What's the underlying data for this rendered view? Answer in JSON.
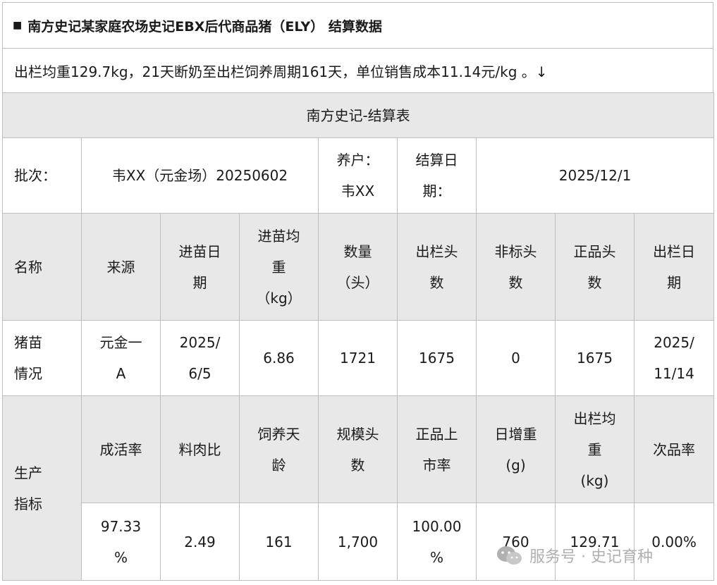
{
  "title": "南方史记某家庭农场史记EBX后代商品猪（ELY） 结算数据",
  "title_marker": "■",
  "summary": "出栏均重129.7kg，21天断奶至出栏饲养周期161天，单位销售成本11.14元/kg 。↓",
  "table": {
    "heading": "南方史记-结算表",
    "batch_label": "批次：",
    "batch_value": "韦XX（元金场）20250602",
    "farmer_label_1": "养户：",
    "farmer_label_2": "韦XX",
    "settle_label_1": "结算日",
    "settle_label_2": "期：",
    "settle_date": "2025/12/1",
    "headers": [
      [
        "名称"
      ],
      [
        "来源"
      ],
      [
        "进苗日",
        "期"
      ],
      [
        "进苗均",
        "重",
        "（kg）"
      ],
      [
        "数量",
        "（头）"
      ],
      [
        "出栏头",
        "数"
      ],
      [
        "非标头",
        "数"
      ],
      [
        "正品头",
        "数"
      ],
      [
        "出栏日",
        "期"
      ]
    ],
    "piglet_row": [
      [
        "猪苗",
        "情况"
      ],
      [
        "元金一",
        "A"
      ],
      [
        "2025/",
        "6/5"
      ],
      [
        "6.86"
      ],
      [
        "1721"
      ],
      [
        "1675"
      ],
      [
        "0"
      ],
      [
        "1675"
      ],
      [
        "2025/",
        "11/14"
      ]
    ],
    "production_label": [
      "生产",
      "指标"
    ],
    "indicator_headers": [
      [
        "成活率"
      ],
      [
        "料肉比"
      ],
      [
        "饲养天",
        "龄"
      ],
      [
        "规模头",
        "数"
      ],
      [
        "正品上",
        "市率"
      ],
      [
        "日增重",
        "(g)"
      ],
      [
        "出栏均",
        "重",
        "(kg)"
      ],
      [
        "次品率"
      ]
    ],
    "indicator_values": [
      [
        "97.33",
        "%"
      ],
      [
        "2.49"
      ],
      [
        "161"
      ],
      [
        "1,700"
      ],
      [
        "100.00",
        "%"
      ],
      [
        "760"
      ],
      [
        "129.71"
      ],
      [
        "0.00%"
      ]
    ]
  },
  "watermark": {
    "text": "服务号 · 史记育种",
    "icon": "wechat-icon"
  }
}
